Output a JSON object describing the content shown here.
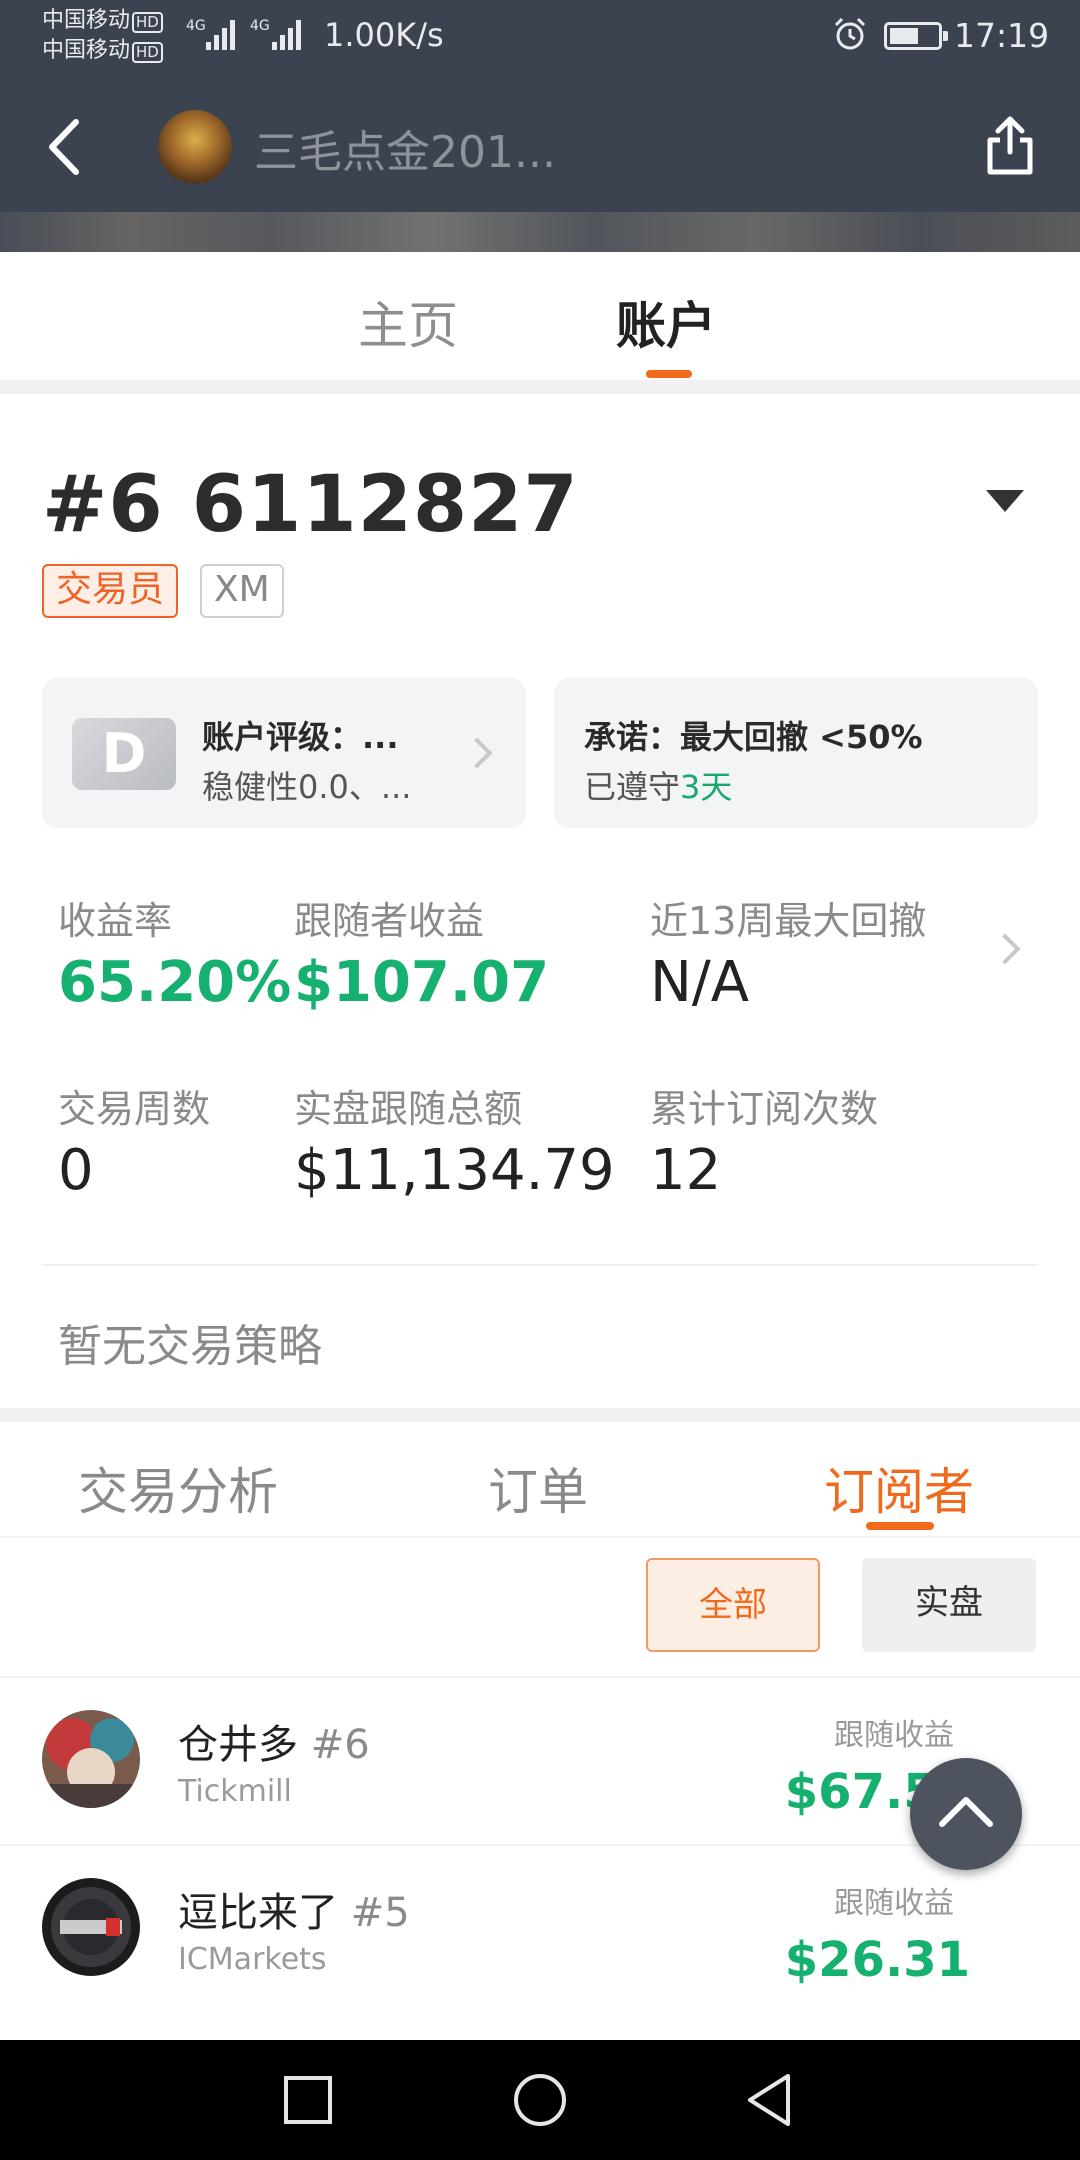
{
  "status_bar": {
    "carrier1": "中国移动",
    "carrier2": "中国移动",
    "hd": "HD",
    "net1": "4G",
    "net2": "4G",
    "speed": "1.00K/s",
    "time": "17:19"
  },
  "header": {
    "title": "三毛点金201..."
  },
  "main_tabs": [
    {
      "label": "主页",
      "active": false
    },
    {
      "label": "账户",
      "active": true
    }
  ],
  "account": {
    "number": "#6 6112827",
    "tag_role": "交易员",
    "tag_broker": "XM",
    "rating": {
      "grade": "D",
      "title": "账户评级：...",
      "subtitle": "稳健性0.0、..."
    },
    "promise": {
      "title": "承诺：最大回撤 <50%",
      "kept_prefix": "已遵守",
      "kept_days": "3天"
    }
  },
  "stats": {
    "return_rate": {
      "label": "收益率",
      "value": "65.20%"
    },
    "follower_profit": {
      "label": "跟随者收益",
      "value": "$107.07"
    },
    "max_drawdown": {
      "label": "近13周最大回撤",
      "value": "N/A"
    },
    "trading_weeks": {
      "label": "交易周数",
      "value": "0"
    },
    "live_follow_total": {
      "label": "实盘跟随总额",
      "value": "$11,134.79"
    },
    "subscriptions": {
      "label": "累计订阅次数",
      "value": "12"
    }
  },
  "strategy": {
    "empty_text": "暂无交易策略"
  },
  "sub_tabs": [
    {
      "label": "交易分析",
      "active": false
    },
    {
      "label": "订单",
      "active": false
    },
    {
      "label": "订阅者",
      "active": true
    }
  ],
  "filters": {
    "all": "全部",
    "real": "实盘"
  },
  "subscribers": [
    {
      "name": "仓井多",
      "rank": "#6",
      "broker": "Tickmill",
      "earn_label": "跟随收益",
      "earn": "$67.55"
    },
    {
      "name": "逗比来了",
      "rank": "#5",
      "broker": "ICMarkets",
      "earn_label": "跟随收益",
      "earn": "$26.31"
    }
  ],
  "colors": {
    "accent_orange": "#f26a1b",
    "profit_green": "#16b070",
    "header_bg": "#3c4350"
  }
}
